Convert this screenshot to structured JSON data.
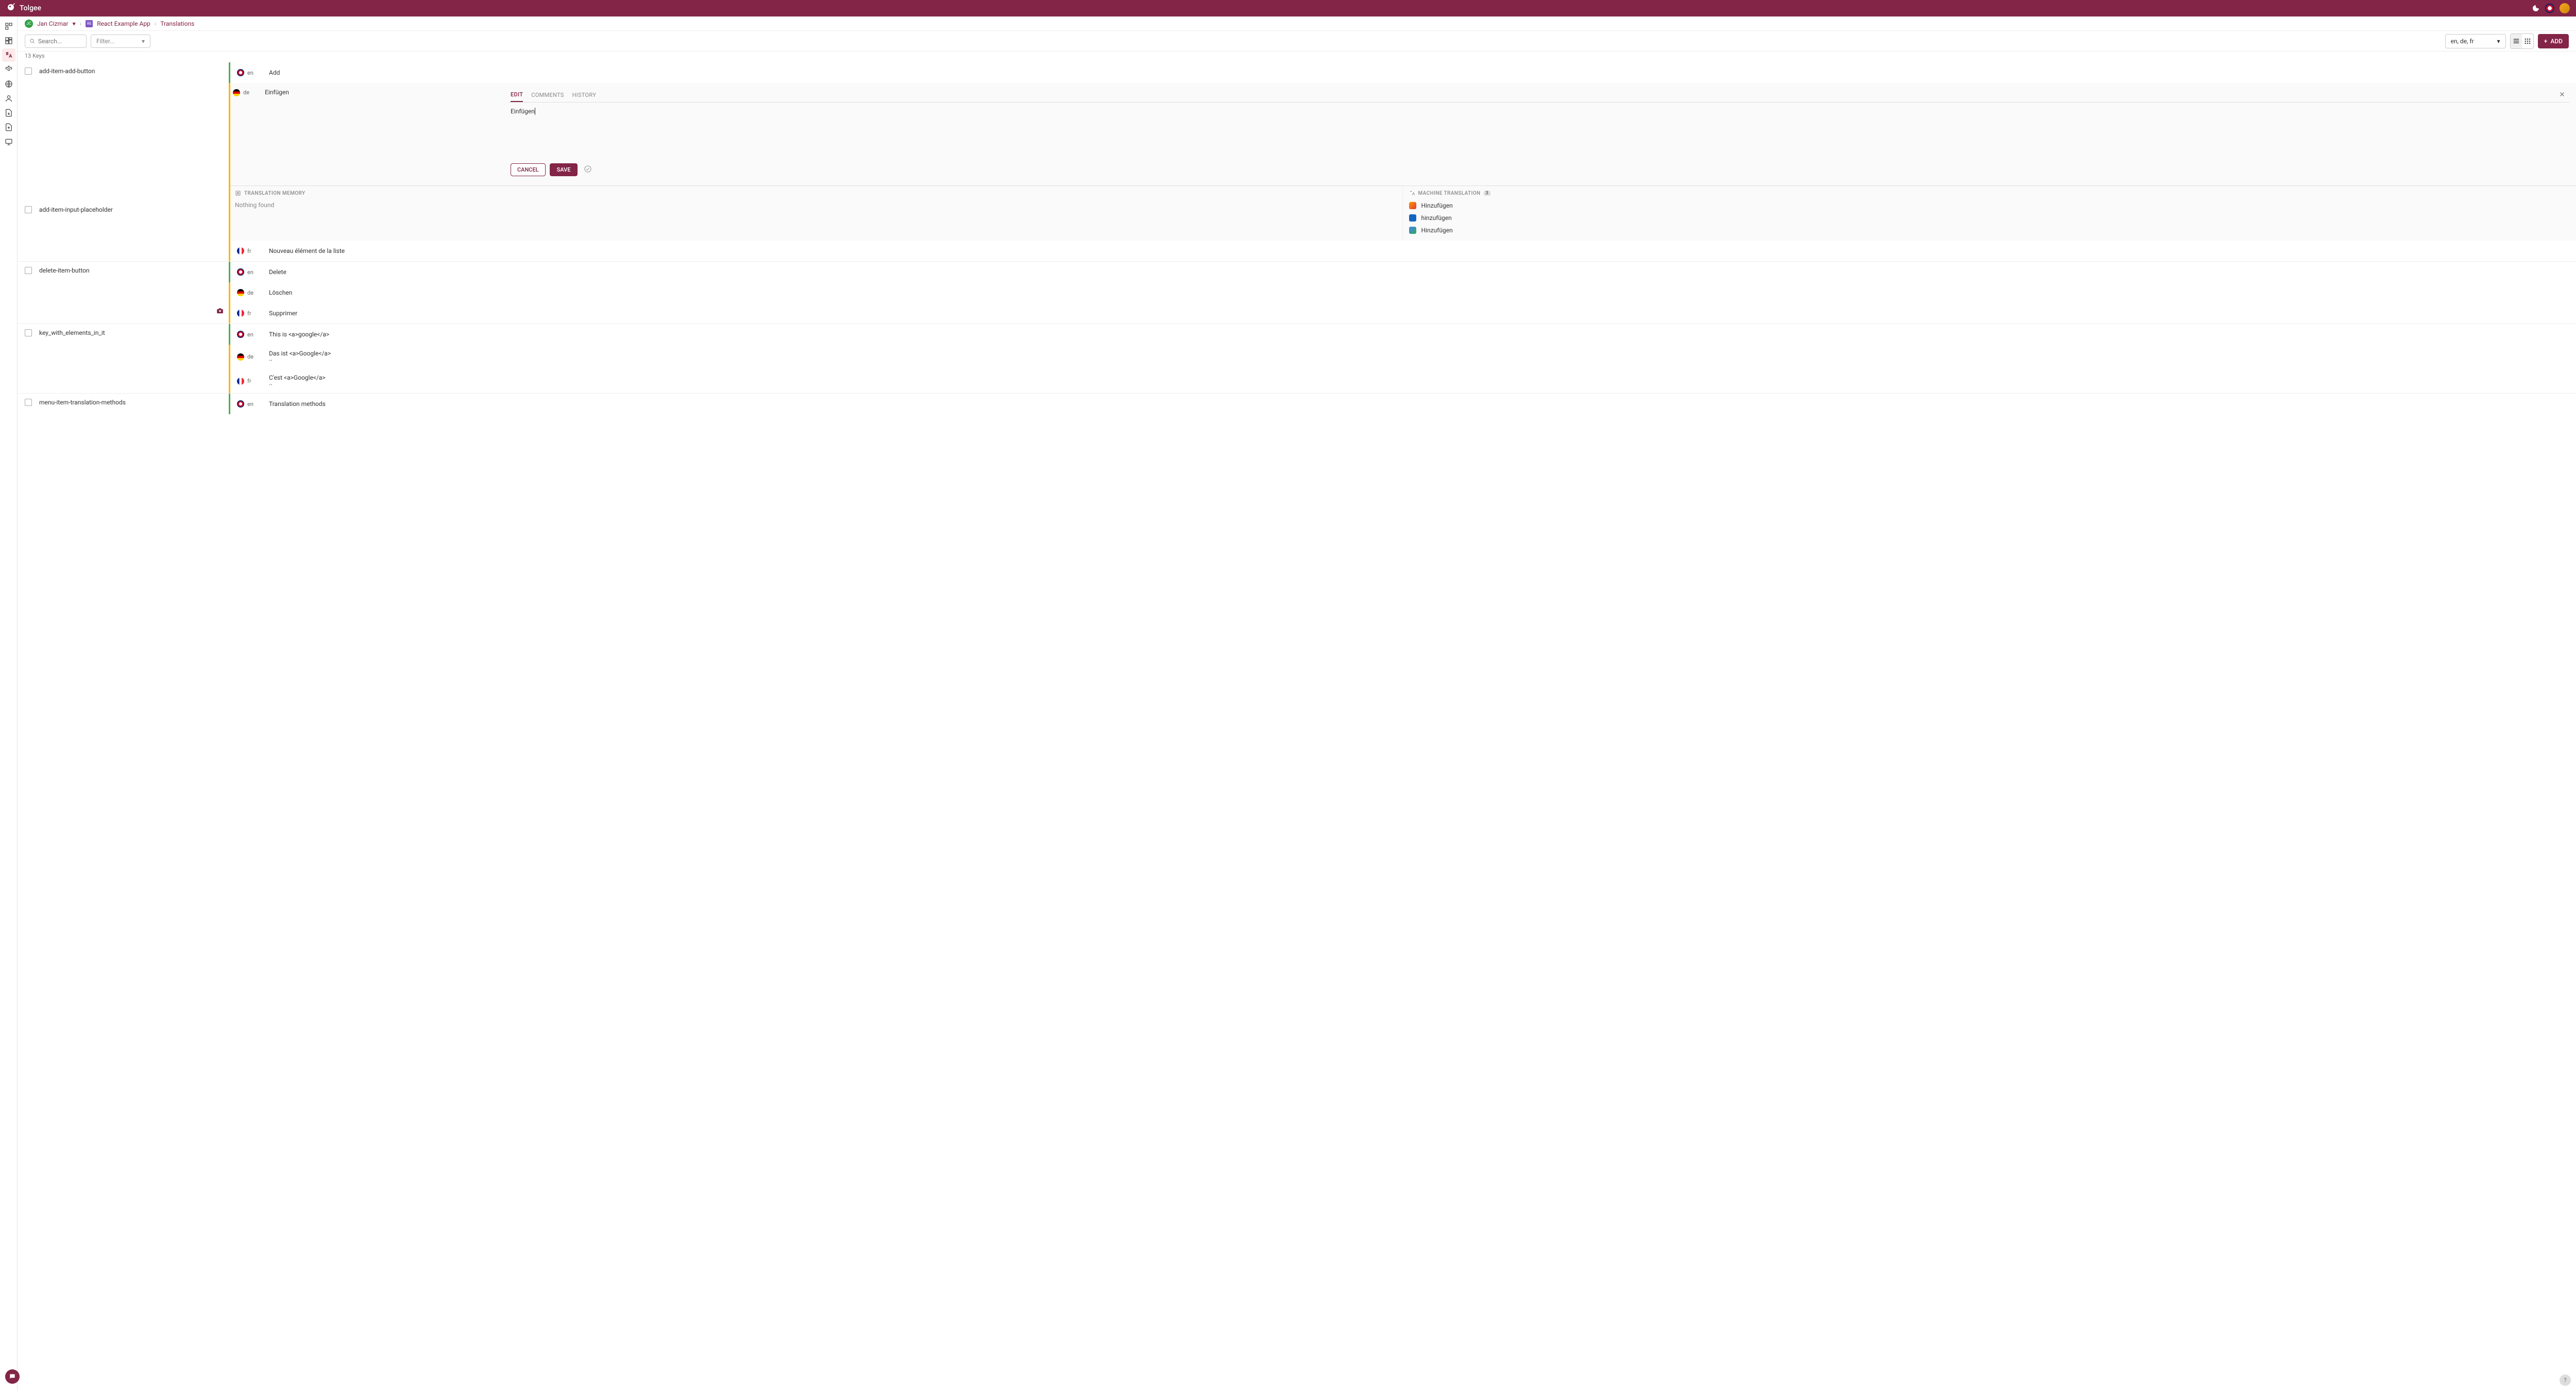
{
  "topbar": {
    "title": "Tolgee"
  },
  "breadcrumb": {
    "badge_initials": "JC",
    "user": "Jan Cizmar",
    "app_badge": "RE",
    "app": "React Example App",
    "page": "Translations"
  },
  "toolbar": {
    "search_placeholder": "Search...",
    "filter_label": "Filter...",
    "lang_select": "en, de, fr",
    "add_label": "ADD"
  },
  "keys_count": "13 Keys",
  "keys": [
    {
      "name": "add-item-add-button",
      "translations": [
        {
          "lang": "en",
          "flag": "flag-en",
          "text": "Add",
          "status": "status-green"
        },
        {
          "lang": "de",
          "flag": "flag-de",
          "text": "Einfügen",
          "status": "status-yellow",
          "expanded": true
        },
        {
          "lang": "fr",
          "flag": "flag-fr",
          "text": "Nouveau élément de la liste",
          "status": "status-yellow"
        }
      ]
    },
    {
      "name": "add-item-input-placeholder",
      "translations": []
    },
    {
      "name": "delete-item-button",
      "translations": [
        {
          "lang": "en",
          "flag": "flag-en",
          "text": "Delete",
          "status": "status-green"
        },
        {
          "lang": "de",
          "flag": "flag-de",
          "text": "Löschen",
          "status": "status-yellow"
        },
        {
          "lang": "fr",
          "flag": "flag-fr",
          "text": "Supprimer",
          "status": "status-yellow"
        }
      ],
      "has_camera": true
    },
    {
      "name": "key_with_elements_in_it",
      "translations": [
        {
          "lang": "en",
          "flag": "flag-en",
          "text": "This is <a>google</a>",
          "status": "status-green"
        },
        {
          "lang": "de",
          "flag": "flag-de",
          "text": "Das ist <a>Google</a>",
          "status": "status-yellow",
          "sub": "••"
        },
        {
          "lang": "fr",
          "flag": "flag-fr",
          "text": "C'est <a>Google</a>",
          "status": "status-yellow",
          "sub": "••"
        }
      ]
    },
    {
      "name": "menu-item-translation-methods",
      "translations": [
        {
          "lang": "en",
          "flag": "flag-en",
          "text": "Translation methods",
          "status": "status-green"
        }
      ]
    }
  ],
  "editor": {
    "tabs": {
      "edit": "EDIT",
      "comments": "COMMENTS",
      "history": "HISTORY"
    },
    "value": "Einfügen",
    "cancel": "CANCEL",
    "save": "SAVE"
  },
  "suggestions": {
    "tm_header": "TRANSLATION MEMORY",
    "tm_empty": "Nothing found",
    "mt_header": "MACHINE TRANSLATION",
    "mt_count": "3",
    "mt_items": [
      {
        "text": "Hinzufügen",
        "color": "#e53935"
      },
      {
        "text": "hinzufügen",
        "color": "#1565c0"
      },
      {
        "text": "Hinzufügen",
        "color": "#4285f4"
      }
    ]
  }
}
